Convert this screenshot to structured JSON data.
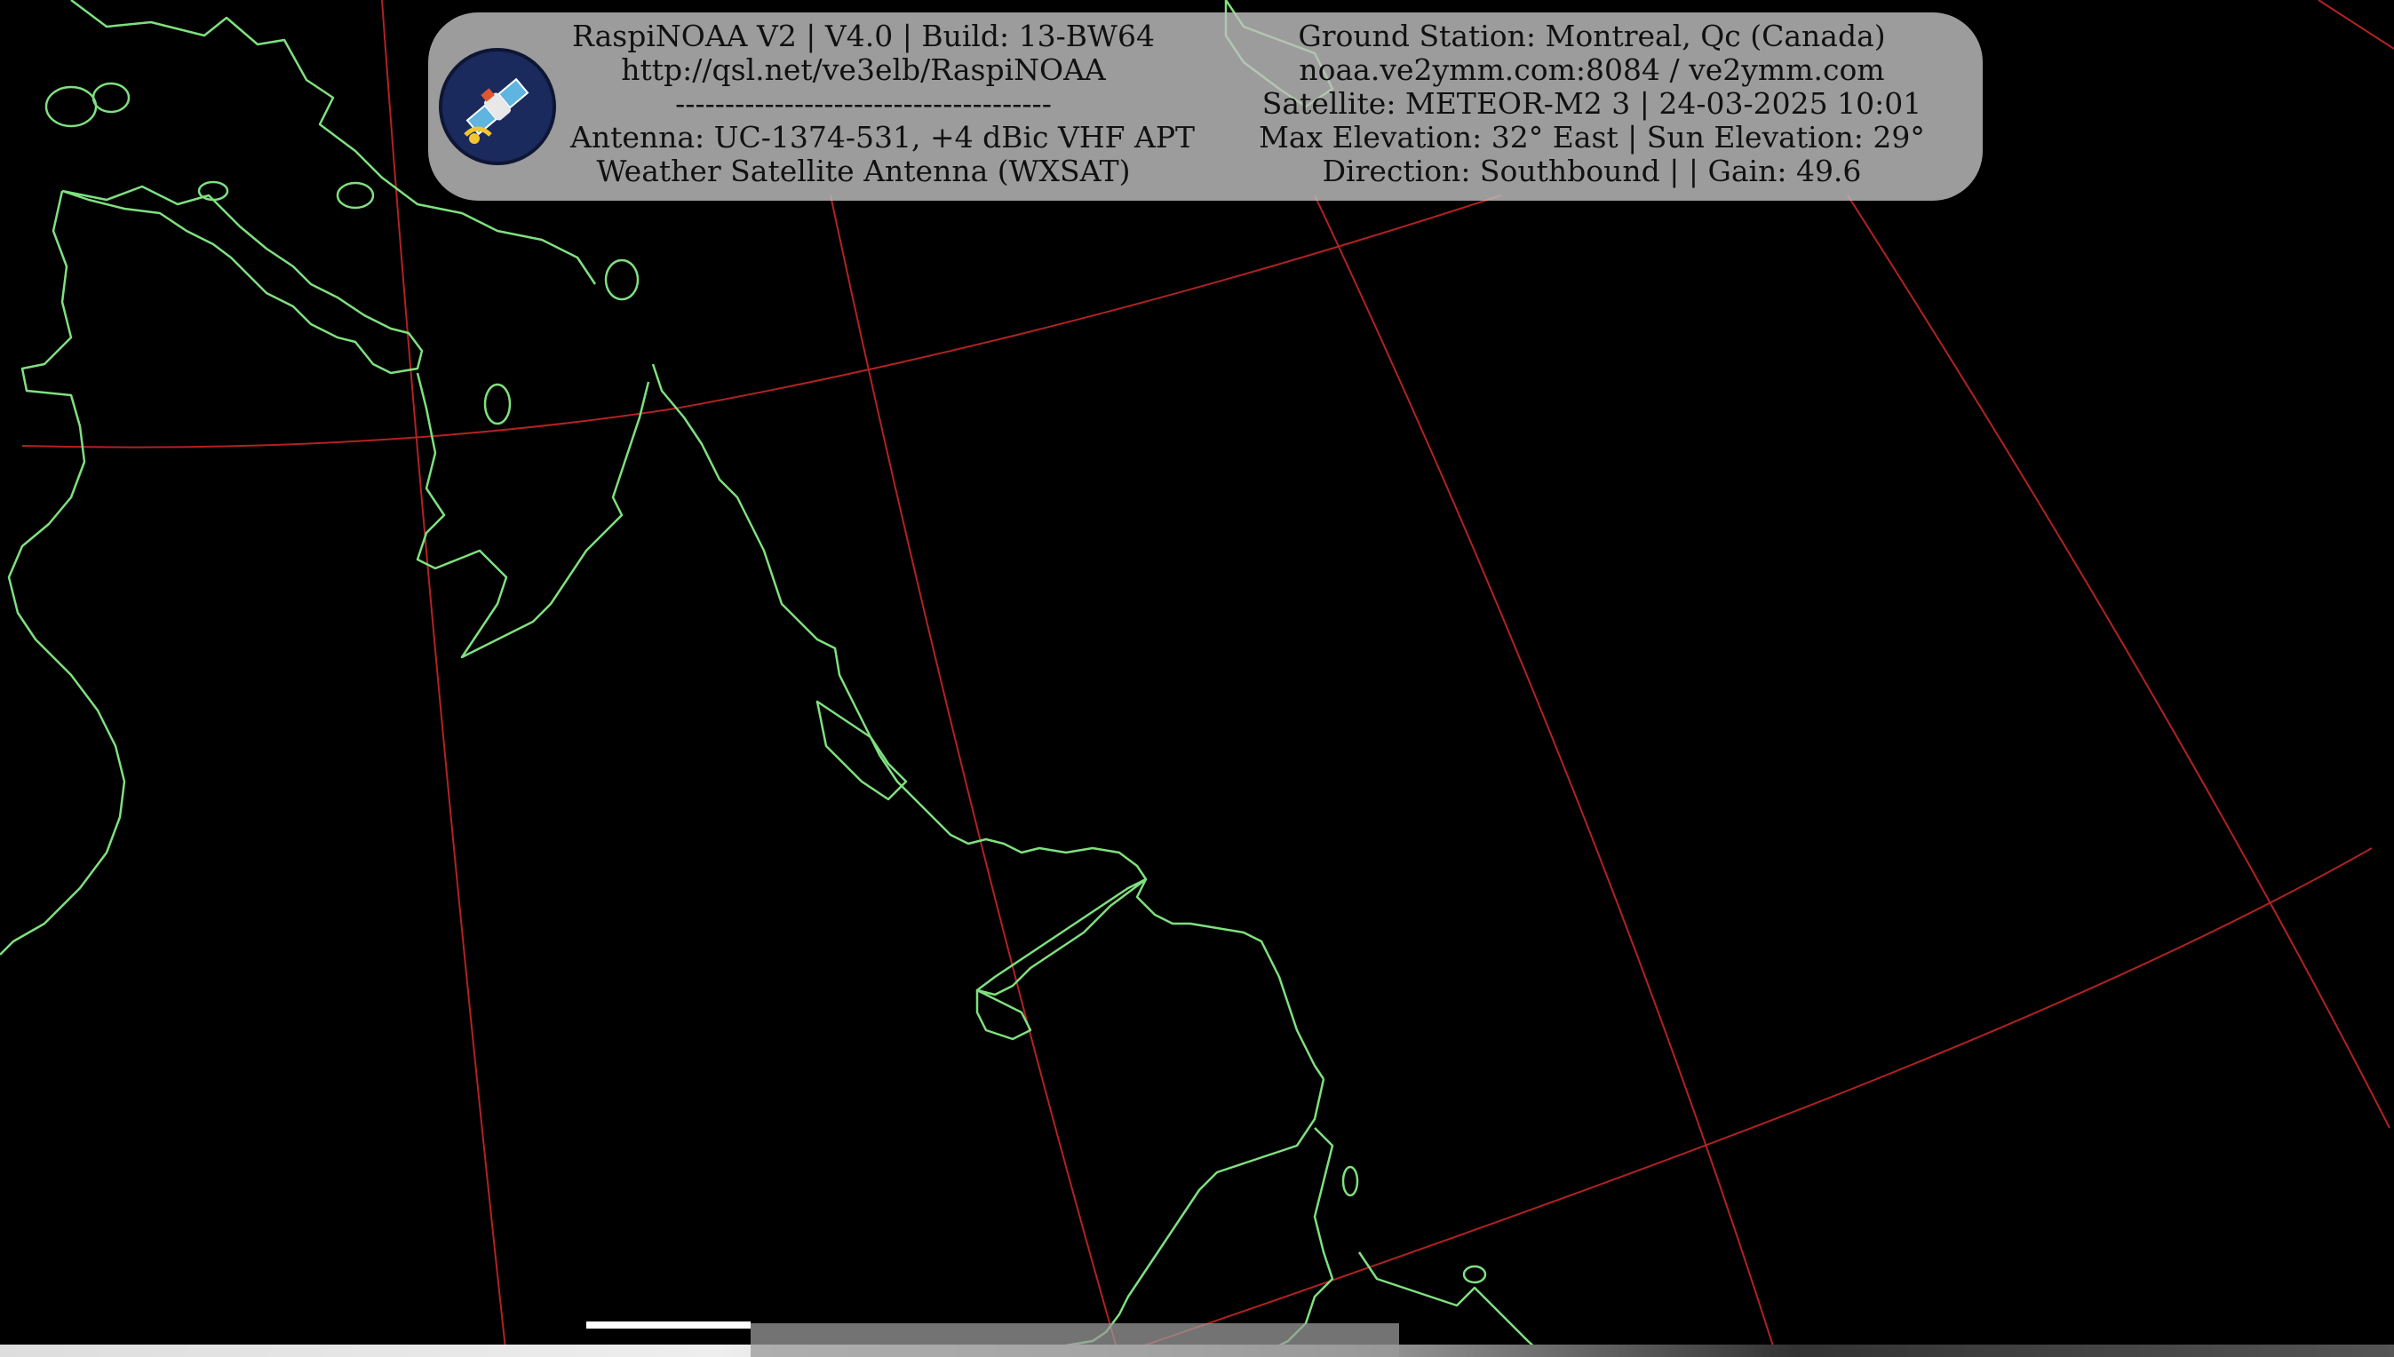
{
  "overlay": {
    "left_lines": [
      "RaspiNOAA V2 | V4.0 | Build: 13-BW64",
      "http://qsl.net/ve3elb/RaspiNOAA",
      "--------------------------------------",
      "Antenna: UC-1374-531, +4 dBic VHF APT",
      "Weather Satellite Antenna (WXSAT)"
    ],
    "right_lines": [
      "Ground Station: Montreal, Qc (Canada)",
      "noaa.ve2ymm.com:8084 / ve2ymm.com",
      "Satellite: METEOR-M2 3 | 24-03-2025 10:01",
      "Max Elevation: 32° East | Sun Elevation: 29°",
      "Direction: Southbound | | Gain: 49.6"
    ],
    "logo_icon": "satellite-icon"
  },
  "map": {
    "background_color": "#000000",
    "coastline_color": "#7fe07f",
    "graticule_color": "#b22222"
  }
}
